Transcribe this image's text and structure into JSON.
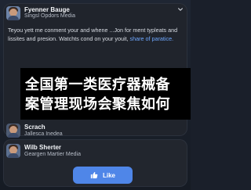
{
  "post": {
    "author_name": "Fyenner Bauge",
    "author_subtitle": "Singsl Opdors Media",
    "body_main": "Teyou yett me conment your and whene ...Jon for ment typleats and lissites and presion. Watchts cond on your youit,",
    "body_link": "share of paratice.",
    "overlay_line1": "全国第一类医疗器械备",
    "overlay_line2": "案管理现场会聚焦如何"
  },
  "comment": {
    "author_name": "Scrach",
    "author_subtitle": "Jallesca Inedea"
  },
  "card2": {
    "author_name": "Wilb Sherter",
    "author_subtitle": "Geargen Martier Media",
    "like_label": "Like"
  },
  "colors": {
    "background": "#1a1f2a",
    "card": "#20242c",
    "link": "#6fa8ff",
    "like_button": "#4f86e8"
  },
  "icons": [
    "chevron-down-icon",
    "thumbs-up-icon"
  ]
}
